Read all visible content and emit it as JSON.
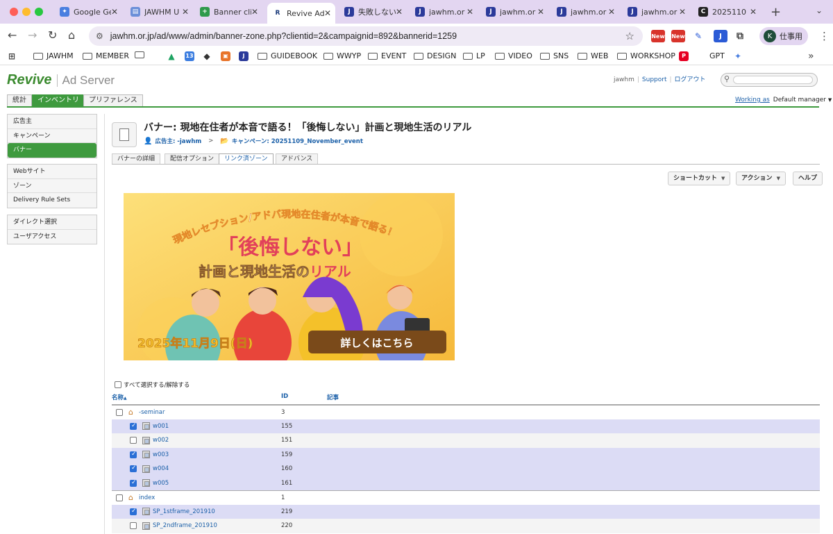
{
  "browser": {
    "tabs": [
      {
        "title": "Google Ge",
        "icon": "gemini-icon",
        "color": "#4a7fe0",
        "glyph": "✦"
      },
      {
        "title": "JAWHM U",
        "icon": "doc-icon",
        "color": "#6b8fd8",
        "glyph": "▤"
      },
      {
        "title": "Banner cli",
        "icon": "sheets-plus-icon",
        "color": "#2e9a4a",
        "glyph": "+"
      },
      {
        "title": "Revive Ad",
        "icon": "revive-icon",
        "color": "#ffffff",
        "glyph": "R"
      },
      {
        "title": "失敗しない",
        "icon": "jawhm-icon",
        "color": "#2b3a9a",
        "glyph": "J"
      },
      {
        "title": "jawhm.or",
        "icon": "jawhm-icon",
        "color": "#2b3a9a",
        "glyph": "J"
      },
      {
        "title": "jawhm.or",
        "icon": "jawhm-icon",
        "color": "#2b3a9a",
        "glyph": "J"
      },
      {
        "title": "jawhm.or",
        "icon": "jawhm-icon",
        "color": "#2b3a9a",
        "glyph": "J"
      },
      {
        "title": "jawhm.or",
        "icon": "jawhm-icon",
        "color": "#2b3a9a",
        "glyph": "J"
      },
      {
        "title": "2025110",
        "icon": "circle-c-icon",
        "color": "#222222",
        "glyph": "C"
      }
    ],
    "active_tab_index": 3,
    "url": "jawhm.or.jp/ad/www/admin/banner-zone.php?clientid=2&campaignid=892&bannerid=1259",
    "profile_initial": "K",
    "profile_label": "仕事用",
    "new_badge": "New",
    "bookmarks": [
      {
        "label": "",
        "kind": "apps"
      },
      {
        "label": "JAWHM",
        "kind": "folder"
      },
      {
        "label": "MEMBER",
        "kind": "folder"
      },
      {
        "label": "",
        "kind": "folder"
      },
      {
        "label": "",
        "kind": "drive"
      },
      {
        "label": "",
        "kind": "calendar"
      },
      {
        "label": "",
        "kind": "diamond"
      },
      {
        "label": "",
        "kind": "square"
      },
      {
        "label": "",
        "kind": "jawhm"
      },
      {
        "label": "GUIDEBOOK",
        "kind": "folder"
      },
      {
        "label": "WWYP",
        "kind": "folder"
      },
      {
        "label": "EVENT",
        "kind": "folder"
      },
      {
        "label": "DESIGN",
        "kind": "folder"
      },
      {
        "label": "LP",
        "kind": "folder"
      },
      {
        "label": "VIDEO",
        "kind": "folder"
      },
      {
        "label": "SNS",
        "kind": "folder"
      },
      {
        "label": "WEB",
        "kind": "folder"
      },
      {
        "label": "WORKSHOP",
        "kind": "folder"
      },
      {
        "label": "",
        "kind": "pinterest"
      },
      {
        "label": "GPT",
        "kind": "text"
      },
      {
        "label": "",
        "kind": "gemini"
      }
    ]
  },
  "app": {
    "logo_brand": "Revive",
    "logo_product": "Ad Server",
    "user": "jawhm",
    "support": "Support",
    "logout": "ログアウト",
    "main_tabs": [
      "統計",
      "インベントリ",
      "プリファレンス"
    ],
    "working_as_label": "Working as",
    "working_as_value": "Default manager",
    "sidebar_group1": [
      "広告主",
      "キャンペーン",
      "バナー"
    ],
    "sidebar_group2": [
      "Webサイト",
      "ゾーン",
      "Delivery Rule Sets"
    ],
    "sidebar_group3": [
      "ダイレクト選択",
      "ユーザアクセス"
    ],
    "title": "バナー: 現地在住者が本音で語る！「後悔しない」計画と現地生活のリアル",
    "breadcrumb_advertiser": "広告主: -jawhm",
    "breadcrumb_sep": ">",
    "breadcrumb_campaign": "キャンペーン: 20251109_November_event",
    "sub_tabs": [
      "バナーの詳細",
      "配信オプション",
      "リンク済ゾーン",
      "アドバンス"
    ],
    "buttons": {
      "shortcut": "ショートカット",
      "action": "アクション",
      "help": "ヘルプ"
    },
    "banner_image": {
      "arc_text": "現地レセプション/アドバ現地在住者が本音で語る！",
      "headline": "「後悔しない」",
      "subhead_a": "計画と",
      "subhead_b": "現地生活の",
      "subhead_c": "リアル",
      "date": "2025年11月9日(日)",
      "cta": "詳しくはこちら"
    },
    "select_all": "すべて選択する/解除する",
    "columns": {
      "name": "名称",
      "sort": "▲",
      "id": "ID",
      "notes": "記事"
    },
    "zone_groups": [
      {
        "name": "-seminar",
        "id": "3",
        "checked": false,
        "zones": [
          {
            "name": "w001",
            "id": "155",
            "checked": true
          },
          {
            "name": "w002",
            "id": "151",
            "checked": false
          },
          {
            "name": "w003",
            "id": "159",
            "checked": true
          },
          {
            "name": "w004",
            "id": "160",
            "checked": true
          },
          {
            "name": "w005",
            "id": "161",
            "checked": true
          }
        ]
      },
      {
        "name": "index",
        "id": "1",
        "checked": false,
        "zones": [
          {
            "name": "SP_1stframe_201910",
            "id": "219",
            "checked": true
          },
          {
            "name": "SP_2ndframe_201910",
            "id": "220",
            "checked": false
          }
        ]
      }
    ]
  }
}
